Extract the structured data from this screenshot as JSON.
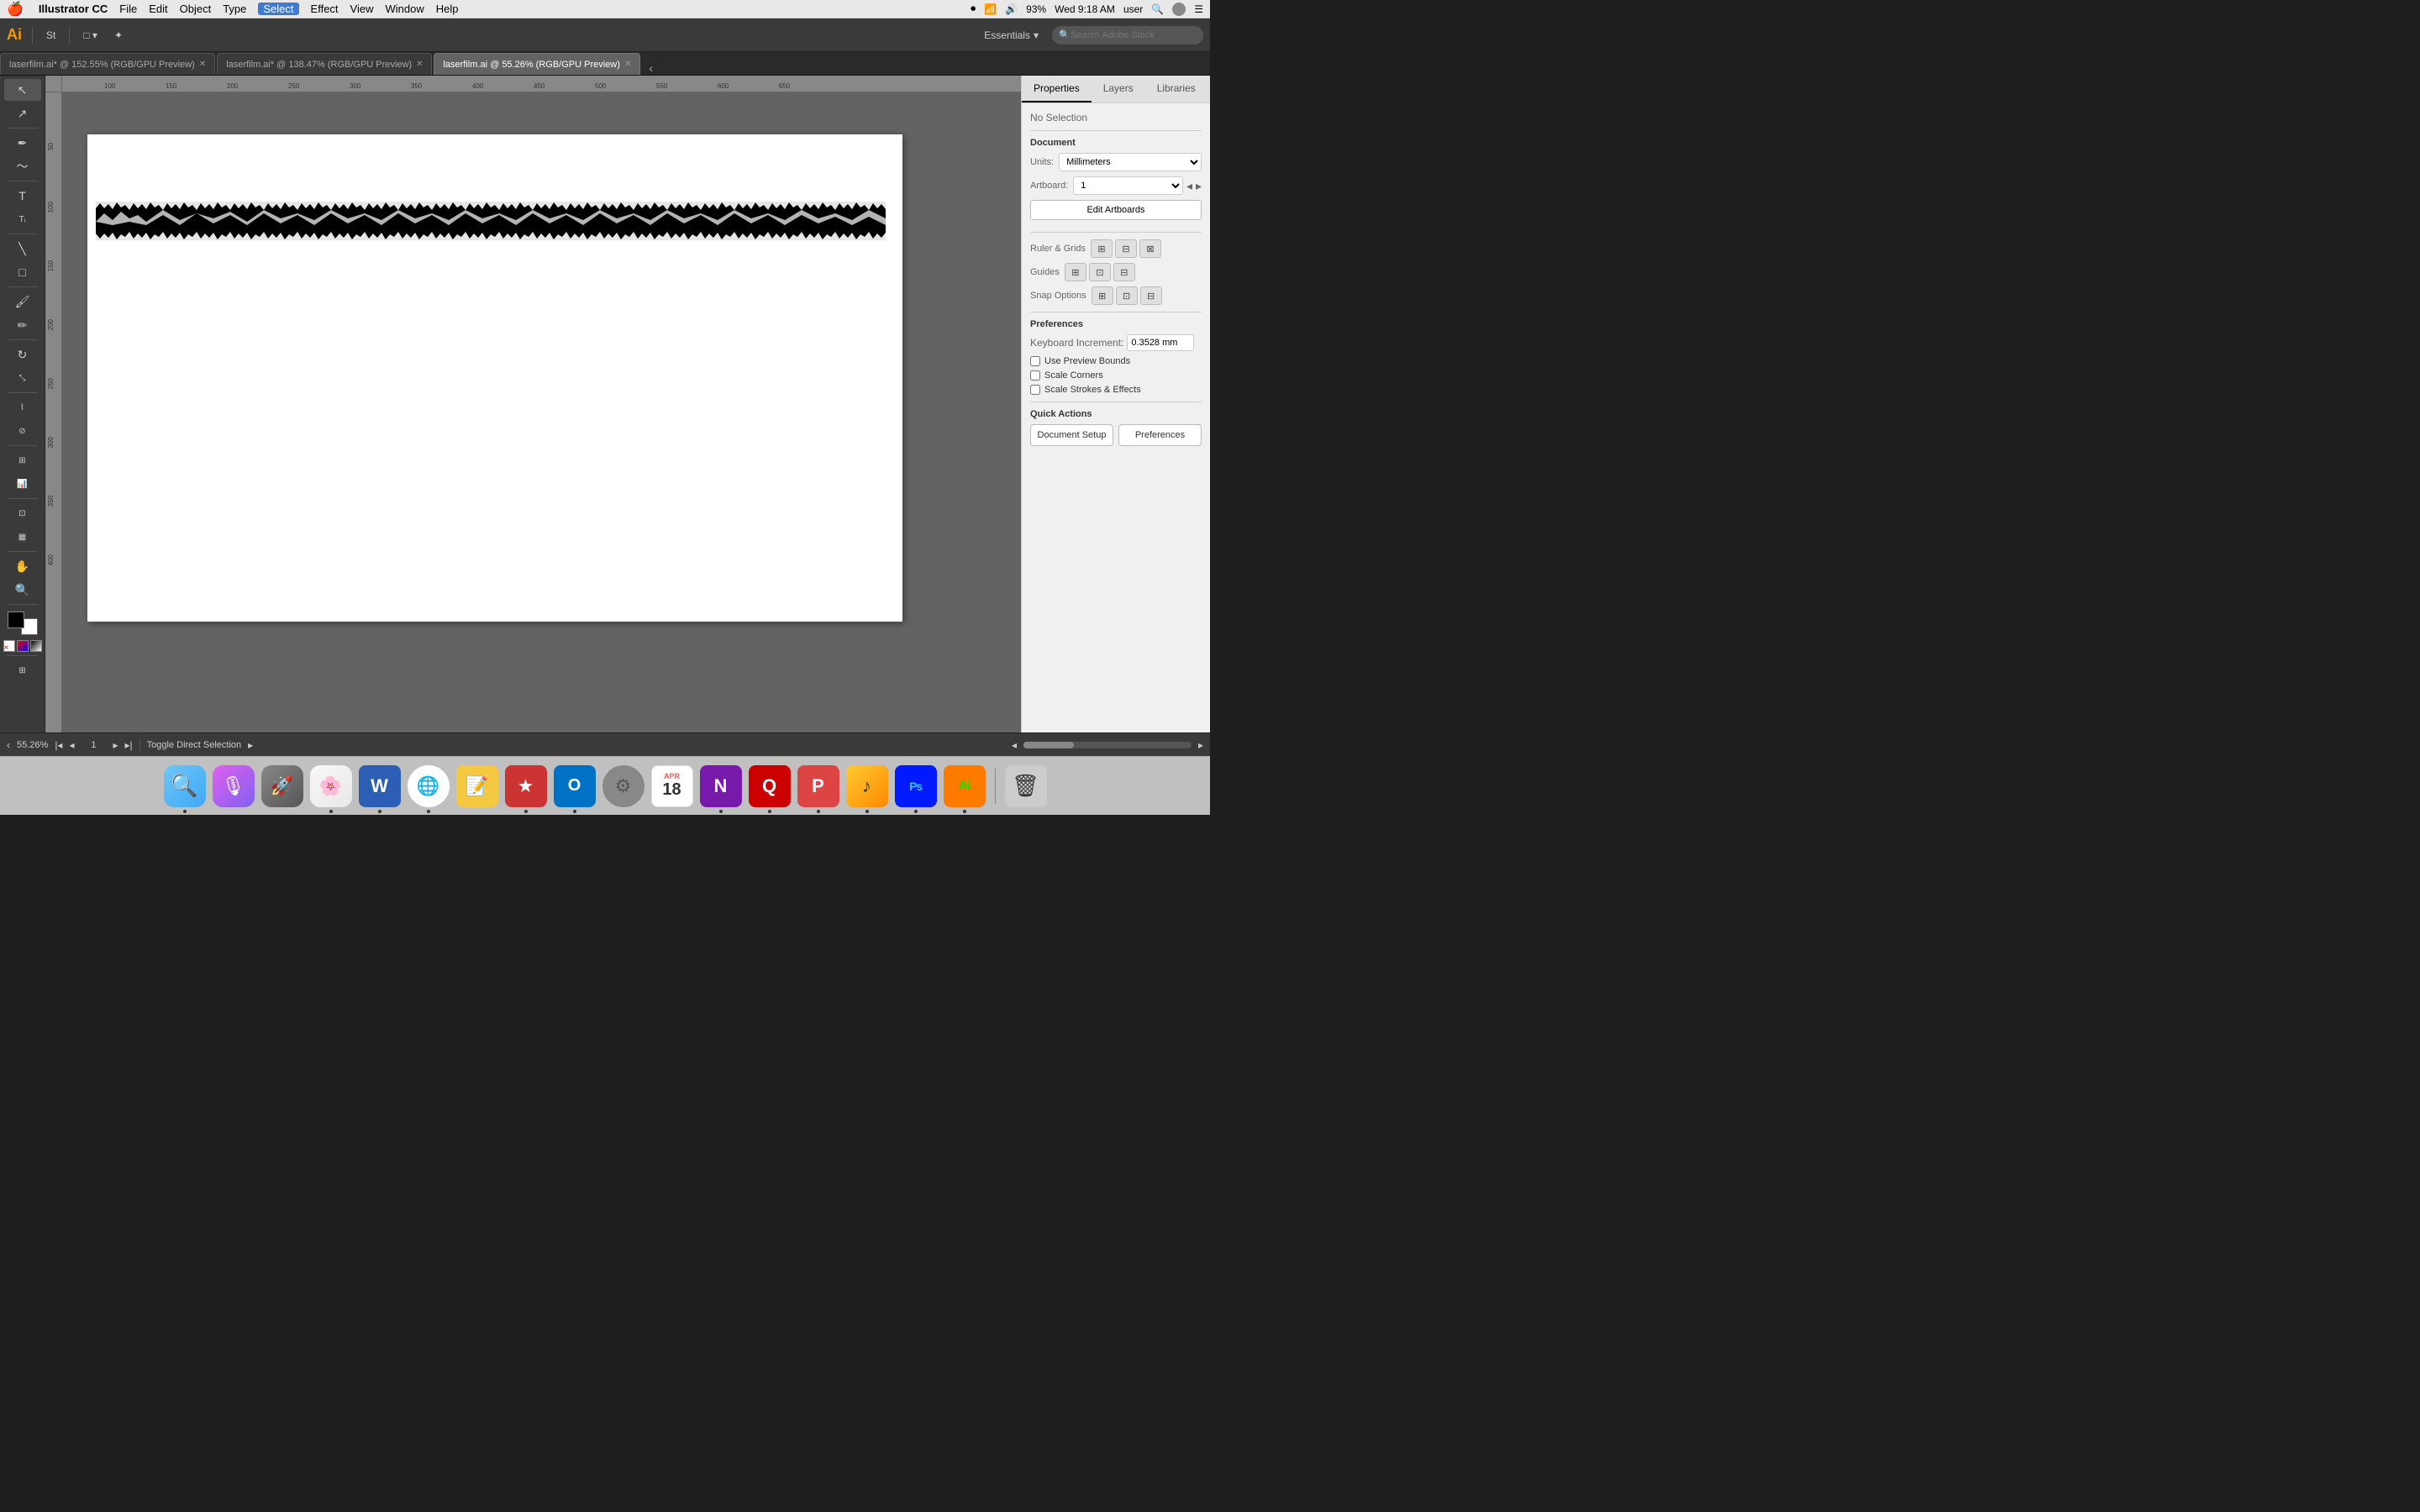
{
  "menubar": {
    "apple": "🍎",
    "app": "Illustrator CC",
    "menus": [
      "File",
      "Edit",
      "Object",
      "Type",
      "Select",
      "Effect",
      "View",
      "Window",
      "Help"
    ],
    "active_menu": "Select",
    "right": {
      "wifi": "WiFi",
      "volume": "🔊",
      "battery": "93%",
      "time": "Wed 9:18 AM",
      "user": "user"
    }
  },
  "toolbar": {
    "logo": "Ai",
    "buttons": [
      "St",
      "□",
      "✦",
      "Essentials"
    ],
    "essentials_label": "Essentials",
    "stock_placeholder": "Search Adobe Stock"
  },
  "tabs": [
    {
      "label": "laserfilm.ai* @ 152.55% (RGB/GPU Preview)",
      "active": false
    },
    {
      "label": "laserfilm.ai* @ 138.47% (RGB/GPU Preview)",
      "active": false
    },
    {
      "label": "laserfilm.ai @ 55.26% (RGB/GPU Preview)",
      "active": true
    }
  ],
  "right_panel": {
    "tabs": [
      "Properties",
      "Layers",
      "Libraries"
    ],
    "active_tab": "Properties",
    "no_selection": "No Selection",
    "document_section": "Document",
    "units_label": "Units:",
    "units_value": "Millimeters",
    "artboard_label": "Artboard:",
    "artboard_value": "1",
    "edit_artboards_label": "Edit Artboards",
    "ruler_grids": "Ruler & Grids",
    "guides": "Guides",
    "snap_options": "Snap Options",
    "preferences_section": "Preferences",
    "keyboard_increment_label": "Keyboard Increment:",
    "keyboard_increment_value": "0.3528 mm",
    "use_preview_bounds": "Use Preview Bounds",
    "scale_corners": "Scale Corners",
    "scale_strokes_effects": "Scale Strokes & Effects",
    "quick_actions": "Quick Actions",
    "document_setup_label": "Document Setup",
    "preferences_label": "Preferences"
  },
  "status_bar": {
    "zoom": "55.26%",
    "artboard_num": "1",
    "action": "Toggle Direct Selection"
  },
  "dock": [
    {
      "icon": "🔍",
      "label": "Finder",
      "color": "#4488ff"
    },
    {
      "icon": "🎙",
      "label": "Siri",
      "color": "#888"
    },
    {
      "icon": "🚀",
      "label": "Launchpad",
      "color": "#555"
    },
    {
      "icon": "🖼",
      "label": "Photos",
      "color": "#aaa"
    },
    {
      "icon": "W",
      "label": "Word",
      "color": "#2b5eb4"
    },
    {
      "icon": "🌐",
      "label": "Chrome",
      "color": "#ccc"
    },
    {
      "icon": "📝",
      "label": "Notes",
      "color": "#f0c040"
    },
    {
      "icon": "★",
      "label": "GoodLinks",
      "color": "#d44"
    },
    {
      "icon": "O",
      "label": "Outlook",
      "color": "#0072c6"
    },
    {
      "icon": "⚙",
      "label": "Settings",
      "color": "#888"
    },
    {
      "icon": "📅",
      "label": "Calendar",
      "color": "#f55"
    },
    {
      "icon": "N",
      "label": "OneNote",
      "color": "#7719aa"
    },
    {
      "icon": "Q",
      "label": "App",
      "color": "#c00"
    },
    {
      "icon": "P",
      "label": "PowerPoint",
      "color": "#d44"
    },
    {
      "icon": "♪",
      "label": "Music",
      "color": "#fc3"
    },
    {
      "icon": "Ps",
      "label": "Photoshop",
      "color": "#001aff"
    },
    {
      "icon": "Ai",
      "label": "Illustrator",
      "color": "#ff7b00"
    },
    {
      "icon": "🗑",
      "label": "Trash",
      "color": "#888"
    }
  ]
}
